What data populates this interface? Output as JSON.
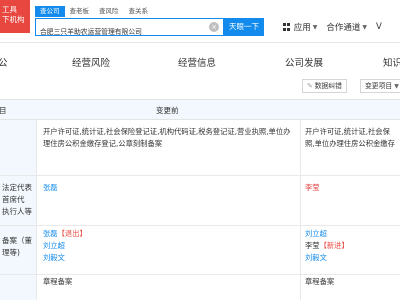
{
  "brand": {
    "line1": "工具",
    "line2": "下机构"
  },
  "search": {
    "tabs": [
      "查公司",
      "查老板",
      "查风险",
      "查关系"
    ],
    "query": "合肥三只羊助农运营管理有限公司",
    "clear_symbol": "×",
    "button": "天眼一下"
  },
  "topnav": {
    "app": "应用",
    "coop": "合作通道",
    "cut": "V"
  },
  "sections": [
    "公",
    "经营风险",
    "经营信息",
    "公司发展",
    "知识"
  ],
  "actions": {
    "report": "数据纠错",
    "change": "变更项目"
  },
  "table": {
    "headers": {
      "item": "目",
      "before": "变更前"
    },
    "rows": [
      {
        "item": [
          ""
        ],
        "before_text": "开户许可证,统计证,社会保险登记证,机构代码证,税务登记证,营业执照,单位办理住房公积金缴存登记,公章刻制备案",
        "after_text": "开户许可证,统计证,社会保\n照,单位办理住房公积金缴存"
      },
      {
        "item": [
          "法定代表",
          "首席代",
          "执行人等"
        ],
        "before_name": "张磊",
        "after_name": "李莹"
      },
      {
        "item": [
          "备案（董",
          "理等)"
        ],
        "before_people": [
          {
            "name": "张磊",
            "tag": "【退出】"
          },
          {
            "name": "刘立超",
            "tag": ""
          },
          {
            "name": "刘毅文",
            "tag": ""
          }
        ],
        "after_people": [
          {
            "name": "刘立超",
            "tag": ""
          },
          {
            "name": "李莹",
            "tag": "【新进】"
          },
          {
            "name": "刘毅文",
            "tag": ""
          }
        ]
      },
      {
        "item": [
          ""
        ],
        "before_text": "章程备案",
        "after_text": "章程备案"
      }
    ]
  }
}
